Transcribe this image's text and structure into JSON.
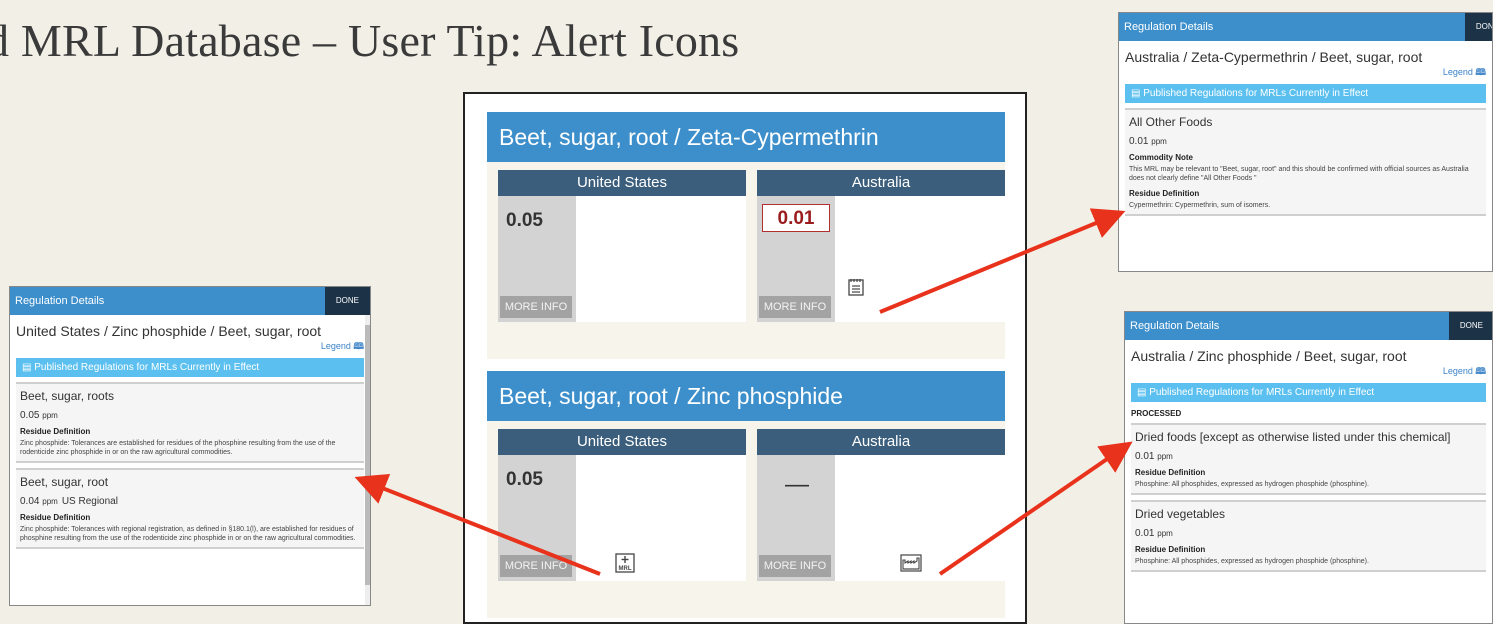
{
  "slide": {
    "title": "d MRL Database – User Tip: Alert Icons"
  },
  "center": {
    "cards": [
      {
        "header": "Beet, sugar, root / Zeta-Cypermethrin",
        "countries": [
          {
            "name": "United States",
            "value": "0.05",
            "more": "MORE INFO",
            "icon": "none"
          },
          {
            "name": "Australia",
            "value": "0.01",
            "more": "MORE INFO",
            "icon": "commodity-note-icon"
          }
        ]
      },
      {
        "header": "Beet, sugar, root / Zinc phosphide",
        "countries": [
          {
            "name": "United States",
            "value": "0.05",
            "more": "MORE INFO",
            "icon": "regional-mrl-icon",
            "icon_text": "MRL"
          },
          {
            "name": "Australia",
            "value": "—",
            "more": "MORE INFO",
            "icon": "processed-factory-icon"
          }
        ]
      }
    ]
  },
  "dialog_left": {
    "header": "Regulation Details",
    "done": "DONE",
    "title": "United States / Zinc phosphide / Beet, sugar, root",
    "legend": "Legend",
    "published": "Published Regulations for MRLs Currently in Effect",
    "entries": [
      {
        "name": "Beet, sugar, roots",
        "value": "0.05",
        "unit": "ppm",
        "label": "Residue Definition",
        "text": "Zinc phosphide: Tolerances are established for residues of the phosphine resulting from the use of the rodenticide zinc phosphide in or on the raw agricultural commodities."
      },
      {
        "name": "Beet, sugar, root",
        "value": "0.04",
        "unit": "ppm",
        "regional": "US Regional",
        "label": "Residue Definition",
        "text": "Zinc phosphide: Tolerances with regional registration, as defined in §180.1(l), are established for residues of phosphine resulting from the use of the rodenticide zinc phosphide in or on the raw agricultural commodities."
      }
    ]
  },
  "dialog_top_right": {
    "header": "Regulation Details",
    "done": "DONE",
    "title": "Australia / Zeta-Cypermethrin / Beet, sugar, root",
    "legend": "Legend",
    "published": "Published Regulations for MRLs Currently in Effect",
    "entries": [
      {
        "name": "All Other Foods",
        "value": "0.01",
        "unit": "ppm",
        "note_label": "Commodity Note",
        "note_text": "This MRL may be relevant to \"Beet, sugar, root\" and this should be confirmed with official sources as Australia does not clearly define \"All Other Foods \"",
        "label": "Residue Definition",
        "text": "Cypermethrin: Cypermethrin, sum of isomers."
      }
    ]
  },
  "dialog_bottom_right": {
    "header": "Regulation Details",
    "done": "DONE",
    "title": "Australia / Zinc phosphide / Beet, sugar, root",
    "legend": "Legend",
    "published": "Published Regulations for MRLs Currently in Effect",
    "section": "PROCESSED",
    "entries": [
      {
        "name": "Dried foods [except as otherwise listed under this chemical]",
        "value": "0.01",
        "unit": "ppm",
        "label": "Residue Definition",
        "text": "Phosphine: All phosphides, expressed as hydrogen phosphide (phosphine)."
      },
      {
        "name": "Dried vegetables",
        "value": "0.01",
        "unit": "ppm",
        "label": "Residue Definition",
        "text": "Phosphine: All phosphides, expressed as hydrogen phosphide (phosphine)."
      }
    ]
  },
  "colors": {
    "header_blue": "#3d8fcb",
    "country_head": "#3b5e7c",
    "published_bar": "#5bc0ef",
    "arrow": "#e8321c",
    "done": "#1c3247"
  }
}
